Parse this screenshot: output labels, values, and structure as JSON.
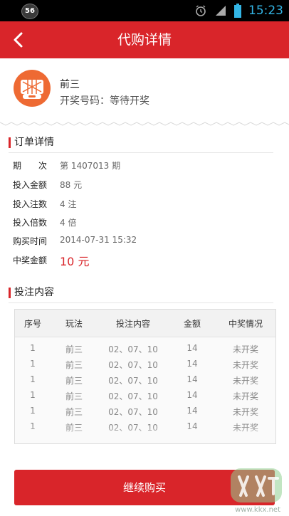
{
  "status_bar": {
    "notification_count": "56",
    "time": "15:23"
  },
  "header": {
    "title": "代购详情"
  },
  "lottery": {
    "name": "前三",
    "status": "开奖号码：等待开奖"
  },
  "order": {
    "section_title": "订单详情",
    "rows": [
      {
        "label": "期　　次",
        "value": "第 1407013 期"
      },
      {
        "label": "投入金额",
        "value": "88 元"
      },
      {
        "label": "投入注数",
        "value": "4 注"
      },
      {
        "label": "投入倍数",
        "value": "4 倍"
      },
      {
        "label": "购买时间",
        "value": "2014-07-31 15:32"
      },
      {
        "label": "中奖金额",
        "value": "10 元"
      }
    ]
  },
  "bets": {
    "section_title": "投注内容",
    "columns": [
      "序号",
      "玩法",
      "投注内容",
      "金额",
      "中奖情况"
    ],
    "rows": [
      [
        "1",
        "前三",
        "02、07、10",
        "14",
        "未开奖"
      ],
      [
        "1",
        "前三",
        "02、07、10",
        "14",
        "未开奖"
      ],
      [
        "1",
        "前三",
        "02、07、10",
        "14",
        "未开奖"
      ],
      [
        "1",
        "前三",
        "02、07、10",
        "14",
        "未开奖"
      ],
      [
        "1",
        "前三",
        "02、07、10",
        "14",
        "未开奖"
      ],
      [
        "1",
        "前三",
        "02、07、10",
        "14",
        "未开奖"
      ]
    ]
  },
  "continue_button": {
    "label": "继续购买"
  },
  "watermark": {
    "text": "www.kkx.net"
  },
  "colors": {
    "brand_red": "#d9252a",
    "logo_orange": "#ee6a33",
    "clock_blue": "#33b5e5"
  }
}
